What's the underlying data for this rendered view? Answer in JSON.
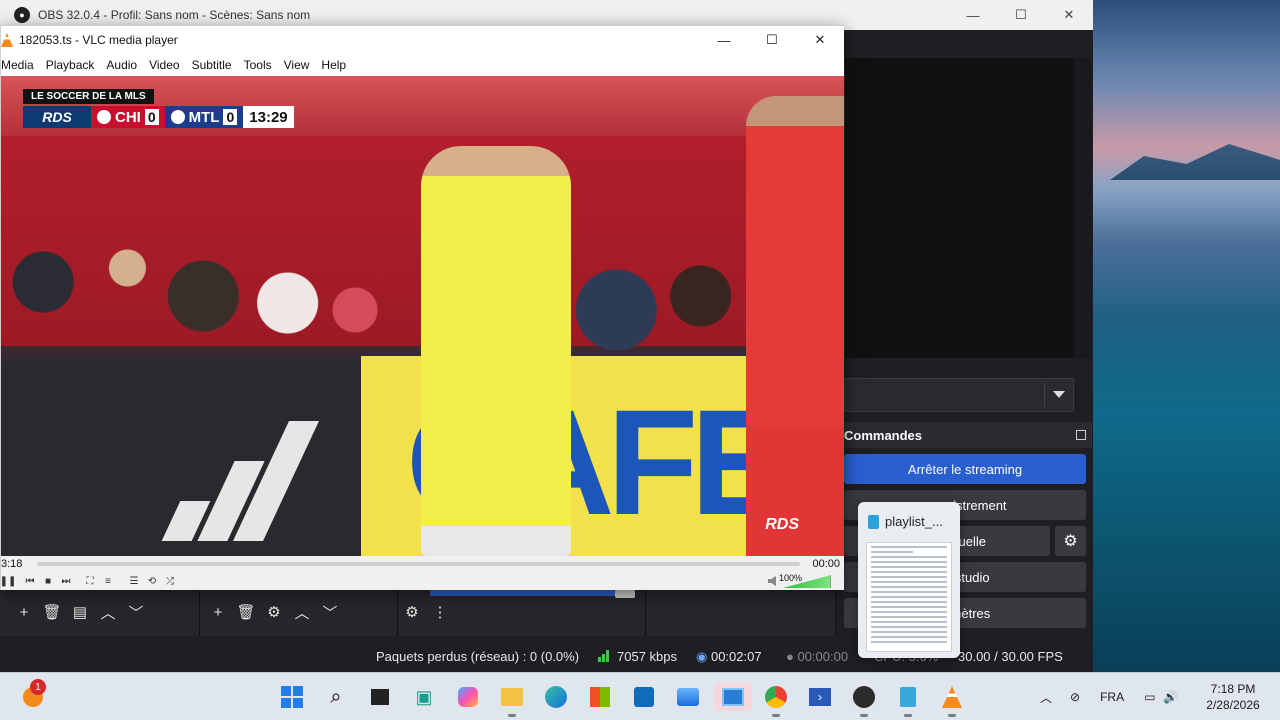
{
  "obs": {
    "title": "OBS 32.0.4 - Profil: Sans nom - Scènes: Sans nom",
    "window_buttons": [
      "—",
      "☐",
      "✕"
    ],
    "commands": {
      "header": "Commandes",
      "stop_streaming": "Arrêter le streaming",
      "recording": "...registrement",
      "virtual_camera": "...éra virtuelle",
      "studio_mode": "... studio",
      "settings": "...mètres"
    },
    "status": {
      "dropped_frames": "Paquets perdus (réseau) : 0 (0.0%)",
      "bitrate": "7057 kbps",
      "stream_time": "00:02:07",
      "rec_time": "00:00:00",
      "cpu": "CPU: 5.6%",
      "fps": "30.00 / 30.00 FPS"
    }
  },
  "vlc": {
    "title": "182053.ts - VLC media player",
    "menu": [
      "Media",
      "Playback",
      "Audio",
      "Video",
      "Subtitle",
      "Tools",
      "View",
      "Help"
    ],
    "elapsed": "3:18",
    "remaining": "00:00",
    "volume": "100%",
    "volume_level": 1.0,
    "scorebug": {
      "league": "LE SOCCER DE LA MLS",
      "network": "RDS",
      "home": "CHI",
      "home_score": "0",
      "away": "MTL",
      "away_score": "0",
      "clock": "13:29"
    },
    "watermark": "RDS"
  },
  "thumbnail": {
    "title": "playlist_..."
  },
  "taskbar": {
    "notification_count": "1",
    "language": "FRA",
    "time": "7:18 PM",
    "date": "2/28/2026"
  }
}
